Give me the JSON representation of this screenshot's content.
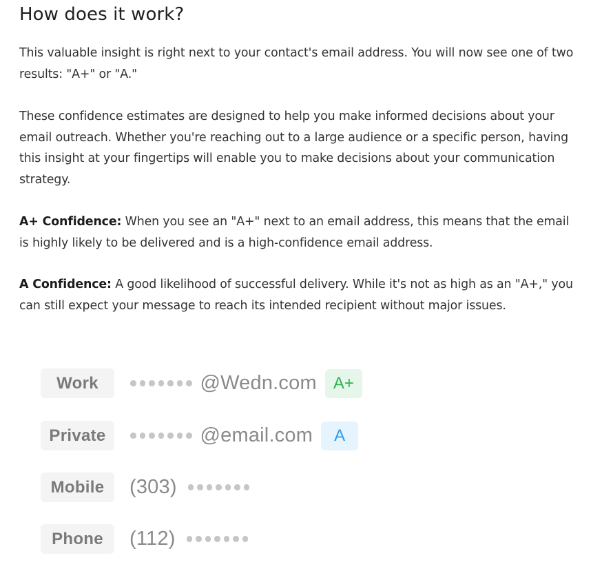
{
  "heading": "How does it work?",
  "paragraphs": {
    "intro": "This valuable insight is right next to your contact's email address. You will now see one of two results: \"A+\" or \"A.\"",
    "estimates": "These confidence estimates are designed to help you make informed decisions about your email outreach. Whether you're reaching out to a large audience or a specific person, having this insight at your fingertips will enable you to make decisions about your communication strategy.",
    "aplus": {
      "term": "A+ Confidence:",
      "text": " When you see an \"A+\" next to an email address, this means that the email is highly likely to be delivered and is a high-confidence email address."
    },
    "a": {
      "term": "A Confidence:",
      "text": " A good likelihood of successful delivery. While it's not as high as an \"A+,\" you can still expect your message to reach its intended recipient without major issues."
    }
  },
  "illustration": {
    "masked_dot_count": 7,
    "rows": [
      {
        "label": "Work",
        "value": "@Wedn.com",
        "badge": "A+",
        "badge_color": "#2bb34f",
        "badge_bg": "#e7f6ea"
      },
      {
        "label": "Private",
        "value": "@email.com",
        "badge": "A",
        "badge_color": "#2f9cf0",
        "badge_bg": "#e6f4fd"
      },
      {
        "label": "Mobile",
        "value": "(303)"
      },
      {
        "label": "Phone",
        "value": "(112)"
      }
    ]
  }
}
